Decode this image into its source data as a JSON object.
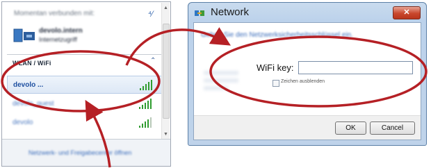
{
  "flyout": {
    "connected_header": "Momentan verbunden mit:",
    "connected_network_name": "devolo.intern",
    "connected_network_sub": "Internetzugriff",
    "section_title": "WLAN / WiFi",
    "networks": [
      {
        "name": "devolo ...",
        "signal_bars": 5
      },
      {
        "name": "devolo_guest",
        "signal_bars": 5
      },
      {
        "name": "devolo",
        "signal_bars": 4
      }
    ],
    "footer_link": "Netzwerk- und Freigabecenter öffnen",
    "signal_color": "#2f9c2f"
  },
  "dialog": {
    "title": "Network",
    "close_symbol": "✕",
    "instruction": "Geben Sie den Netzwerksicherheitsschlüssel ein.",
    "key_label": "WiFi key:",
    "key_value": "",
    "hide_chars_label": "Zeichen ausblenden",
    "ok_label": "OK",
    "cancel_label": "Cancel"
  },
  "annotation": {
    "color": "#b52025"
  }
}
